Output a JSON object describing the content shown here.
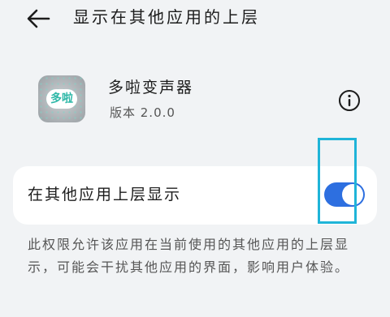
{
  "header": {
    "title": "显示在其他应用的上层",
    "back_icon": "back-arrow-icon"
  },
  "app": {
    "name": "多啦变声器",
    "version": "版本 2.0.0",
    "logo_text": "多啦",
    "info_icon": "info-icon"
  },
  "setting": {
    "label": "在其他应用上层显示",
    "enabled": true
  },
  "description": "此权限允许该应用在当前使用的其他应用的上层显示，可能会干扰其他应用的界面，影响用户体验。",
  "colors": {
    "accent": "#2d6fe0",
    "highlight": "#1fb4d8",
    "background": "#f1f3f5"
  }
}
